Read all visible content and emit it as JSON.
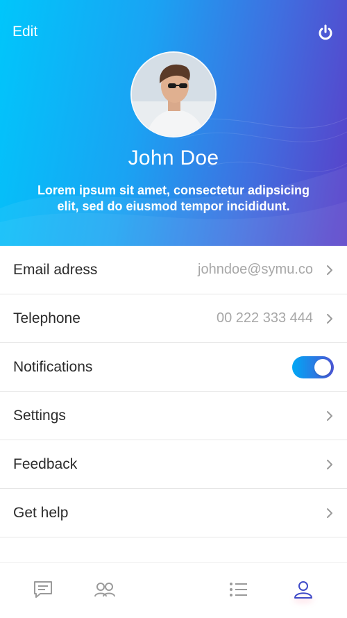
{
  "header": {
    "edit_label": "Edit",
    "name": "John Doe",
    "bio": "Lorem ipsum sit amet, consectetur adipsicing elit, sed do eiusmod tempor incididunt.",
    "gradient_colors": [
      "#00c6fb",
      "#5a3fc8"
    ]
  },
  "rows": {
    "email": {
      "label": "Email adress",
      "value": "johndoe@symu.co"
    },
    "telephone": {
      "label": "Telephone",
      "value": "00 222 333 444"
    },
    "notifications": {
      "label": "Notifications",
      "enabled": true
    },
    "settings": {
      "label": "Settings"
    },
    "feedback": {
      "label": "Feedback"
    },
    "help": {
      "label": "Get help"
    }
  },
  "tab_bar": {
    "tabs": [
      {
        "icon": "chat-icon",
        "active": false
      },
      {
        "icon": "people-icon",
        "active": false
      },
      {
        "icon": "list-icon",
        "active": false
      },
      {
        "icon": "profile-icon",
        "active": true
      }
    ],
    "active_color": "#3f4bc8",
    "inactive_color": "#9a9a9a"
  }
}
